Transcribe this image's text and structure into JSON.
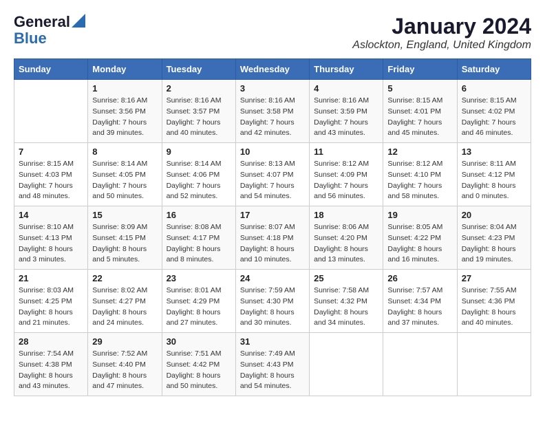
{
  "header": {
    "logo_general": "General",
    "logo_blue": "Blue",
    "month_title": "January 2024",
    "location": "Aslockton, England, United Kingdom"
  },
  "days_of_week": [
    "Sunday",
    "Monday",
    "Tuesday",
    "Wednesday",
    "Thursday",
    "Friday",
    "Saturday"
  ],
  "weeks": [
    [
      {
        "day": "",
        "info": ""
      },
      {
        "day": "1",
        "info": "Sunrise: 8:16 AM\nSunset: 3:56 PM\nDaylight: 7 hours\nand 39 minutes."
      },
      {
        "day": "2",
        "info": "Sunrise: 8:16 AM\nSunset: 3:57 PM\nDaylight: 7 hours\nand 40 minutes."
      },
      {
        "day": "3",
        "info": "Sunrise: 8:16 AM\nSunset: 3:58 PM\nDaylight: 7 hours\nand 42 minutes."
      },
      {
        "day": "4",
        "info": "Sunrise: 8:16 AM\nSunset: 3:59 PM\nDaylight: 7 hours\nand 43 minutes."
      },
      {
        "day": "5",
        "info": "Sunrise: 8:15 AM\nSunset: 4:01 PM\nDaylight: 7 hours\nand 45 minutes."
      },
      {
        "day": "6",
        "info": "Sunrise: 8:15 AM\nSunset: 4:02 PM\nDaylight: 7 hours\nand 46 minutes."
      }
    ],
    [
      {
        "day": "7",
        "info": "Sunrise: 8:15 AM\nSunset: 4:03 PM\nDaylight: 7 hours\nand 48 minutes."
      },
      {
        "day": "8",
        "info": "Sunrise: 8:14 AM\nSunset: 4:05 PM\nDaylight: 7 hours\nand 50 minutes."
      },
      {
        "day": "9",
        "info": "Sunrise: 8:14 AM\nSunset: 4:06 PM\nDaylight: 7 hours\nand 52 minutes."
      },
      {
        "day": "10",
        "info": "Sunrise: 8:13 AM\nSunset: 4:07 PM\nDaylight: 7 hours\nand 54 minutes."
      },
      {
        "day": "11",
        "info": "Sunrise: 8:12 AM\nSunset: 4:09 PM\nDaylight: 7 hours\nand 56 minutes."
      },
      {
        "day": "12",
        "info": "Sunrise: 8:12 AM\nSunset: 4:10 PM\nDaylight: 7 hours\nand 58 minutes."
      },
      {
        "day": "13",
        "info": "Sunrise: 8:11 AM\nSunset: 4:12 PM\nDaylight: 8 hours\nand 0 minutes."
      }
    ],
    [
      {
        "day": "14",
        "info": "Sunrise: 8:10 AM\nSunset: 4:13 PM\nDaylight: 8 hours\nand 3 minutes."
      },
      {
        "day": "15",
        "info": "Sunrise: 8:09 AM\nSunset: 4:15 PM\nDaylight: 8 hours\nand 5 minutes."
      },
      {
        "day": "16",
        "info": "Sunrise: 8:08 AM\nSunset: 4:17 PM\nDaylight: 8 hours\nand 8 minutes."
      },
      {
        "day": "17",
        "info": "Sunrise: 8:07 AM\nSunset: 4:18 PM\nDaylight: 8 hours\nand 10 minutes."
      },
      {
        "day": "18",
        "info": "Sunrise: 8:06 AM\nSunset: 4:20 PM\nDaylight: 8 hours\nand 13 minutes."
      },
      {
        "day": "19",
        "info": "Sunrise: 8:05 AM\nSunset: 4:22 PM\nDaylight: 8 hours\nand 16 minutes."
      },
      {
        "day": "20",
        "info": "Sunrise: 8:04 AM\nSunset: 4:23 PM\nDaylight: 8 hours\nand 19 minutes."
      }
    ],
    [
      {
        "day": "21",
        "info": "Sunrise: 8:03 AM\nSunset: 4:25 PM\nDaylight: 8 hours\nand 21 minutes."
      },
      {
        "day": "22",
        "info": "Sunrise: 8:02 AM\nSunset: 4:27 PM\nDaylight: 8 hours\nand 24 minutes."
      },
      {
        "day": "23",
        "info": "Sunrise: 8:01 AM\nSunset: 4:29 PM\nDaylight: 8 hours\nand 27 minutes."
      },
      {
        "day": "24",
        "info": "Sunrise: 7:59 AM\nSunset: 4:30 PM\nDaylight: 8 hours\nand 30 minutes."
      },
      {
        "day": "25",
        "info": "Sunrise: 7:58 AM\nSunset: 4:32 PM\nDaylight: 8 hours\nand 34 minutes."
      },
      {
        "day": "26",
        "info": "Sunrise: 7:57 AM\nSunset: 4:34 PM\nDaylight: 8 hours\nand 37 minutes."
      },
      {
        "day": "27",
        "info": "Sunrise: 7:55 AM\nSunset: 4:36 PM\nDaylight: 8 hours\nand 40 minutes."
      }
    ],
    [
      {
        "day": "28",
        "info": "Sunrise: 7:54 AM\nSunset: 4:38 PM\nDaylight: 8 hours\nand 43 minutes."
      },
      {
        "day": "29",
        "info": "Sunrise: 7:52 AM\nSunset: 4:40 PM\nDaylight: 8 hours\nand 47 minutes."
      },
      {
        "day": "30",
        "info": "Sunrise: 7:51 AM\nSunset: 4:42 PM\nDaylight: 8 hours\nand 50 minutes."
      },
      {
        "day": "31",
        "info": "Sunrise: 7:49 AM\nSunset: 4:43 PM\nDaylight: 8 hours\nand 54 minutes."
      },
      {
        "day": "",
        "info": ""
      },
      {
        "day": "",
        "info": ""
      },
      {
        "day": "",
        "info": ""
      }
    ]
  ]
}
